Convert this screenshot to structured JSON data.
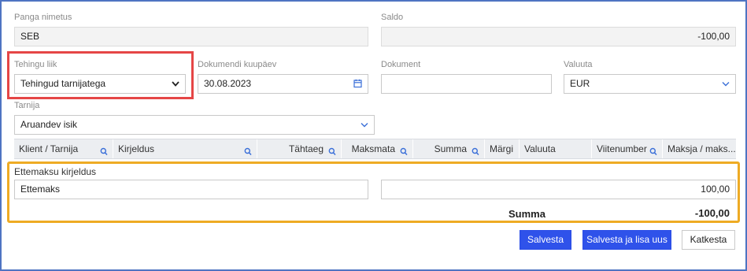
{
  "form": {
    "bank_name": {
      "label": "Panga nimetus",
      "value": "SEB"
    },
    "saldo": {
      "label": "Saldo",
      "value": "-100,00"
    },
    "transaction_type": {
      "label": "Tehingu liik",
      "value": "Tehingud tarnijatega"
    },
    "document_date": {
      "label": "Dokumendi kuupäev",
      "value": "30.08.2023"
    },
    "document": {
      "label": "Dokument",
      "value": ""
    },
    "currency": {
      "label": "Valuuta",
      "value": "EUR"
    },
    "supplier": {
      "label": "Tarnija",
      "value": "Aruandev isik"
    }
  },
  "grid": {
    "columns": [
      {
        "label": "Klient / Tarnija",
        "searchable": true
      },
      {
        "label": "Kirjeldus",
        "searchable": true
      },
      {
        "label": "Tähtaeg",
        "searchable": true
      },
      {
        "label": "Maksmata",
        "searchable": true
      },
      {
        "label": "Summa",
        "searchable": true
      },
      {
        "label": "Märgi",
        "searchable": false
      },
      {
        "label": "Valuuta",
        "searchable": false
      },
      {
        "label": "Viitenumber",
        "searchable": true
      },
      {
        "label": "Maksja / maks...",
        "searchable": false
      }
    ]
  },
  "prepayment": {
    "label": "Ettemaksu kirjeldus",
    "description": "Ettemaks",
    "amount": "100,00"
  },
  "summary": {
    "label": "Summa",
    "value": "-100,00"
  },
  "actions": {
    "save": "Salvesta",
    "save_add": "Salvesta ja lisa uus",
    "cancel": "Katkesta"
  },
  "colors": {
    "highlight_red": "#e54646",
    "highlight_orange": "#eeab24",
    "primary_button": "#2f52ea",
    "frame_border": "#4f74c2",
    "icon_blue": "#3a6fd8"
  },
  "icons": {
    "dropdown": "chevron-down-icon",
    "date": "calendar-icon",
    "search": "search-icon"
  }
}
